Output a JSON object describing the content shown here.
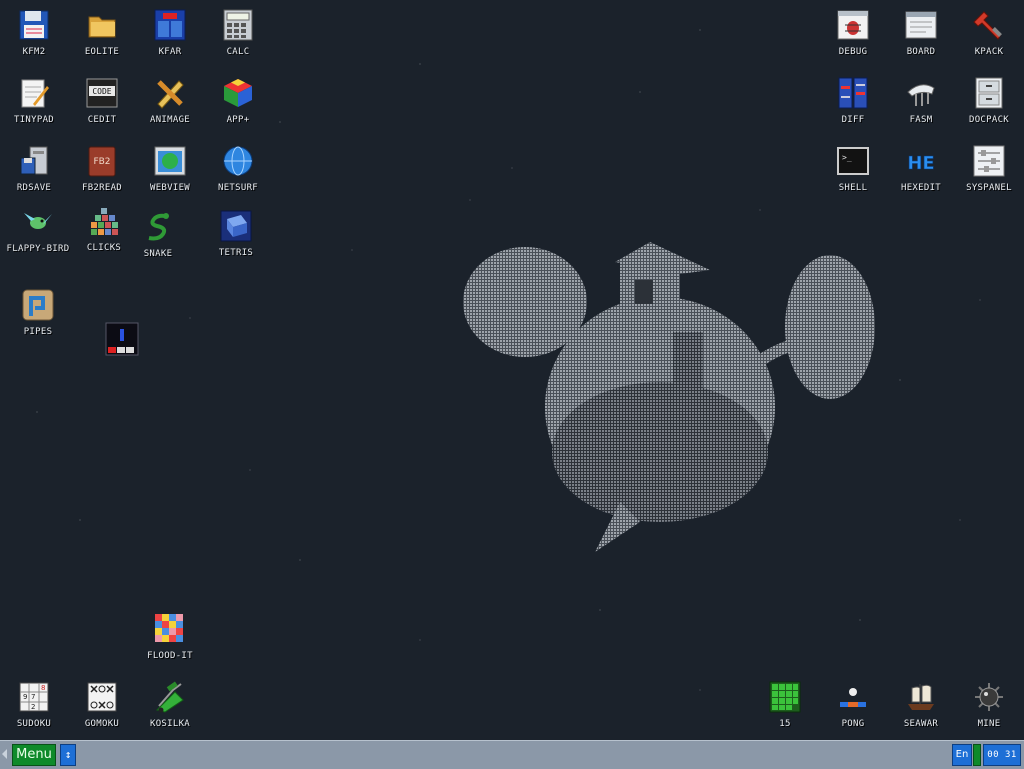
{
  "desktop": {
    "icons_left": [
      {
        "label": "KFM2",
        "icon": "floppy-disk-icon"
      },
      {
        "label": "EOLITE",
        "icon": "folder-icon"
      },
      {
        "label": "KFAR",
        "icon": "file-manager-icon"
      },
      {
        "label": "CALC",
        "icon": "calculator-icon"
      },
      {
        "label": "TINYPAD",
        "icon": "notepad-icon"
      },
      {
        "label": "CEDIT",
        "icon": "code-editor-icon"
      },
      {
        "label": "ANIMAGE",
        "icon": "pencil-ruler-icon"
      },
      {
        "label": "APP+",
        "icon": "rubik-cube-icon"
      },
      {
        "label": "RDSAVE",
        "icon": "ramdisk-save-icon"
      },
      {
        "label": "FB2READ",
        "icon": "book-icon"
      },
      {
        "label": "WEBVIEW",
        "icon": "globe-window-icon"
      },
      {
        "label": "NETSURF",
        "icon": "netsurf-globe-icon"
      },
      {
        "label": "FLAPPY-BIRD",
        "icon": "bird-icon"
      },
      {
        "label": "CLICKS",
        "icon": "blocks-icon"
      },
      {
        "label": "SNAKE",
        "icon": "snake-icon"
      },
      {
        "label": "TETRIS",
        "icon": "tetris-icon"
      },
      {
        "label": "PIPES",
        "icon": "pipes-icon"
      }
    ],
    "icons_right": [
      {
        "label": "DEBUG",
        "icon": "bug-window-icon"
      },
      {
        "label": "BOARD",
        "icon": "board-icon"
      },
      {
        "label": "KPACK",
        "icon": "wrench-icon"
      },
      {
        "label": "DIFF",
        "icon": "diff-icon"
      },
      {
        "label": "FASM",
        "icon": "fasm-icon"
      },
      {
        "label": "DOCPACK",
        "icon": "cabinet-icon"
      },
      {
        "label": "SHELL",
        "icon": "terminal-icon"
      },
      {
        "label": "HEXEDIT",
        "icon": "hex-editor-icon"
      },
      {
        "label": "SYSPANEL",
        "icon": "sliders-icon"
      }
    ],
    "icons_bottom_left": [
      {
        "label": "FLOOD-IT",
        "icon": "color-grid-icon"
      },
      {
        "label": "SUDOKU",
        "icon": "sudoku-icon"
      },
      {
        "label": "GOMOKU",
        "icon": "gomoku-icon"
      },
      {
        "label": "KOSILKA",
        "icon": "lawnmower-icon"
      }
    ],
    "icons_bottom_right": [
      {
        "label": "15",
        "icon": "fifteen-puzzle-icon"
      },
      {
        "label": "PONG",
        "icon": "pong-icon"
      },
      {
        "label": "SEAWAR",
        "icon": "ship-icon"
      },
      {
        "label": "MINE",
        "icon": "mine-icon"
      }
    ],
    "unlabeled_icon": "tetris-window-icon",
    "wallpaper": "treehouse-planet-art"
  },
  "taskbar": {
    "menu_label": "Menu",
    "switch_label": "↕",
    "language": "En",
    "clock": "00 31"
  },
  "colors": {
    "desktop_bg": "#1b222b",
    "taskbar_bg": "#8b98a8",
    "menu_green": "#0e8a2a",
    "accent_blue": "#1d6fd6"
  }
}
